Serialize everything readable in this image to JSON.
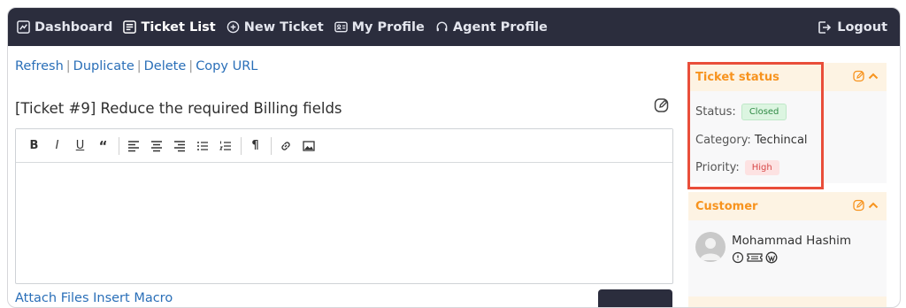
{
  "nav": {
    "items": [
      {
        "label": "Dashboard",
        "icon": "chart-icon"
      },
      {
        "label": "Ticket List",
        "icon": "list-icon",
        "active": true
      },
      {
        "label": "New Ticket",
        "icon": "plus-circle-icon"
      },
      {
        "label": "My Profile",
        "icon": "id-card-icon"
      },
      {
        "label": "Agent Profile",
        "icon": "headset-icon"
      }
    ],
    "logout": "Logout"
  },
  "actions": [
    "Refresh",
    "Duplicate",
    "Delete",
    "Copy URL"
  ],
  "ticket": {
    "title": "[Ticket #9] Reduce the required Billing fields"
  },
  "editor": {
    "toolbar": [
      "B",
      "I",
      "U",
      "“",
      "align-left",
      "align-center",
      "align-right",
      "bullet-list",
      "numbered-list",
      "¶",
      "link",
      "image"
    ]
  },
  "attach": "Attach Files  Insert Macro",
  "status_panel": {
    "title": "Ticket status",
    "status_label": "Status:",
    "status_value": "Closed",
    "category_label": "Category:",
    "category_value": "Techincal",
    "priority_label": "Priority:",
    "priority_value": "High"
  },
  "customer_panel": {
    "title": "Customer",
    "name": "Mohammad Hashim"
  },
  "colors": {
    "nav_bg": "#2b2d3d",
    "accent_orange": "#f7931e",
    "link_blue": "#2a6fb8",
    "highlight_red": "#e94e3a"
  }
}
